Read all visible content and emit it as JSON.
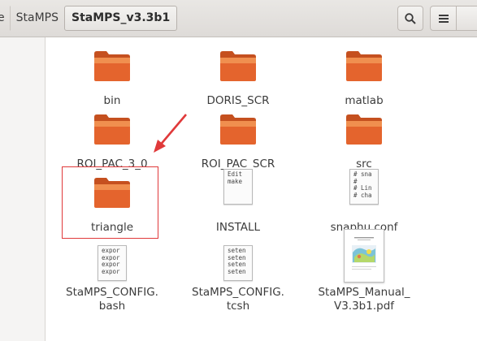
{
  "header": {
    "breadcrumbs": [
      {
        "label": "e",
        "kind": "partial"
      },
      {
        "label": "StaMPS",
        "kind": "mid"
      },
      {
        "label": "StaMPS_v3.3b1",
        "kind": "current"
      }
    ],
    "search_icon": "search-icon",
    "list_view_icon": "list-view-icon"
  },
  "colors": {
    "folder_body": "#e4642d",
    "folder_top": "#f08f4f",
    "selection_outline": "#e0393a",
    "annotation_arrow": "#e0393a"
  },
  "files": [
    {
      "name": "bin",
      "type": "folder"
    },
    {
      "name": "DORIS_SCR",
      "type": "folder"
    },
    {
      "name": "matlab",
      "type": "folder"
    },
    {
      "name": "ROI_PAC_3_0",
      "type": "folder"
    },
    {
      "name": "ROI_PAC_SCR",
      "type": "folder"
    },
    {
      "name": "src",
      "type": "folder"
    },
    {
      "name": "triangle",
      "type": "folder"
    },
    {
      "name": "INSTALL",
      "type": "text",
      "preview": [
        "Edit",
        "",
        "make"
      ]
    },
    {
      "name": "snaphu.conf",
      "type": "text",
      "preview": [
        "# sna",
        "#",
        "# Lin",
        "# cha"
      ]
    },
    {
      "name": "StaMPS_CONFIG.\nbash",
      "type": "text",
      "preview": [
        "expor",
        "expor",
        "expor",
        "expor"
      ]
    },
    {
      "name": "StaMPS_CONFIG.\ntcsh",
      "type": "text",
      "preview": [
        "seten",
        "seten",
        "seten",
        "seten"
      ]
    },
    {
      "name": "StaMPS_Manual_\nV3.3b1.pdf",
      "type": "pdf"
    }
  ]
}
